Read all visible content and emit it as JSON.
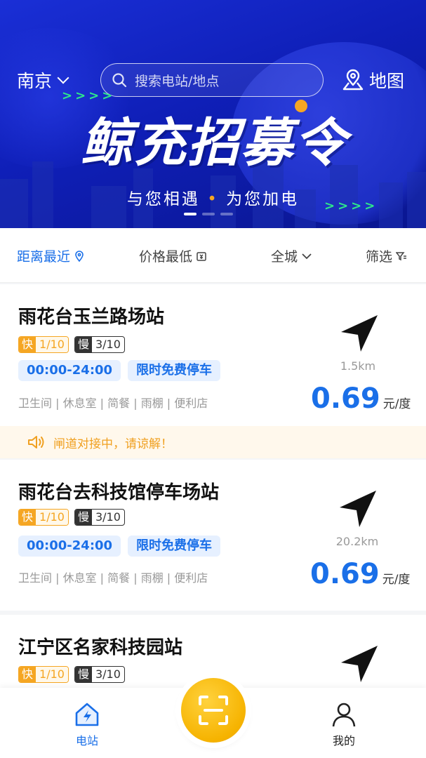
{
  "banner": {
    "city": "南京",
    "search_placeholder": "搜索电站/地点",
    "map_label": "地图",
    "headline": "鲸充招募令",
    "arrows": ">>>>",
    "subtitle_left": "与您相遇",
    "subtitle_dot": "•",
    "subtitle_right": "为您加电"
  },
  "filters": {
    "nearest": "距离最近",
    "cheapest": "价格最低",
    "city_wide": "全城",
    "filter": "筛选"
  },
  "stations": [
    {
      "name": "雨花台玉兰路场站",
      "fast_key": "快",
      "fast_val": "1/10",
      "slow_key": "慢",
      "slow_val": "3/10",
      "hours": "00:00-24:00",
      "parking": "限时免费停车",
      "amenities": "卫生间 | 休息室 | 简餐 | 雨棚 | 便利店",
      "distance": "1.5km",
      "price": "0.69",
      "unit": "元/度"
    },
    {
      "name": "雨花台去科技馆停车场站",
      "fast_key": "快",
      "fast_val": "1/10",
      "slow_key": "慢",
      "slow_val": "3/10",
      "hours": "00:00-24:00",
      "parking": "限时免费停车",
      "amenities": "卫生间 | 休息室 | 简餐 | 雨棚 | 便利店",
      "distance": "20.2km",
      "price": "0.69",
      "unit": "元/度"
    },
    {
      "name": "江宁区名家科技园站",
      "fast_key": "快",
      "fast_val": "1/10",
      "slow_key": "慢",
      "slow_val": "3/10"
    }
  ],
  "notice": "闸道对接中，请谅解！",
  "bottom_nav": {
    "station": "电站",
    "mine": "我的"
  },
  "colors": {
    "accent": "#1a6fe8",
    "fast": "#f5a623",
    "banner": "#1a2fd6",
    "scan": "#f6b300"
  }
}
